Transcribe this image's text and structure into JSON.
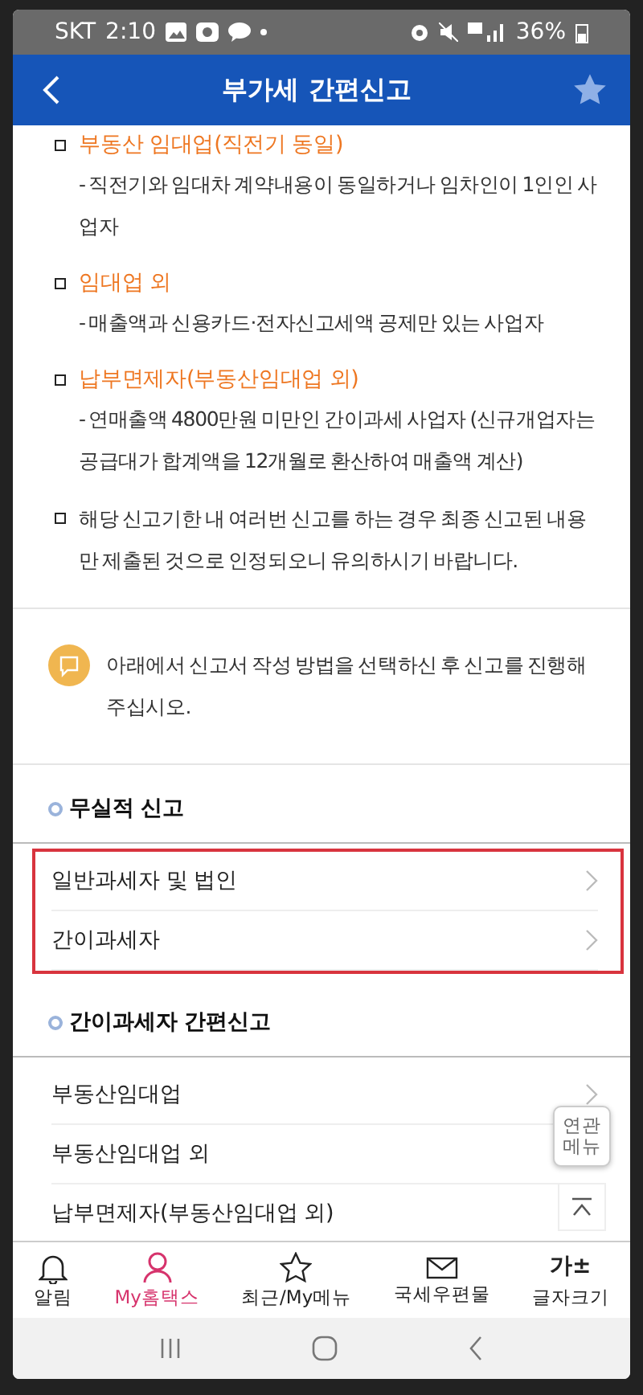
{
  "status_bar": {
    "carrier": "SKT",
    "time": "2:10",
    "battery": "36%"
  },
  "header": {
    "title": "부가세 간편신고",
    "favorite": false
  },
  "notices": [
    {
      "kind": "titled",
      "title": "부동산 임대업(직전기 동일)",
      "text": "- 직전기와 임대차 계약내용이 동일하거나 임차인이 1인인 사업자"
    },
    {
      "kind": "titled",
      "title": "임대업 외",
      "text": "- 매출액과 신용카드·전자신고세액 공제만 있는 사업자"
    },
    {
      "kind": "titled",
      "title": "납부면제자(부동산임대업 외)",
      "text": "- 연매출액 4800만원 미만인 간이과세 사업자 (신규개업자는 공급대가 합계액을 12개월로 환산하여 매출액 계산)"
    },
    {
      "kind": "plain",
      "text": "해당 신고기한 내 여러번 신고를 하는 경우 최종 신고된 내용만 제출된 것으로 인정되오니 유의하시기 바랍니다."
    }
  ],
  "info": "아래에서 신고서 작성 방법을 선택하신 후 신고를 진행해 주십시오.",
  "sections": [
    {
      "title": "무실적 신고",
      "highlighted": true,
      "items": [
        {
          "label": "일반과세자 및 법인",
          "arrow": true
        },
        {
          "label": "간이과세자",
          "arrow": true
        }
      ]
    },
    {
      "title": "간이과세자 간편신고",
      "highlighted": false,
      "items": [
        {
          "label": "부동산임대업",
          "arrow": true
        },
        {
          "label": "부동산임대업 외"
        },
        {
          "label": "납부면제자(부동산임대업 외)"
        }
      ]
    }
  ],
  "floating": {
    "related_menu": [
      "연관",
      "메뉴"
    ]
  },
  "bottom_nav": [
    {
      "kind": "bell",
      "label": "알림",
      "selected": false
    },
    {
      "kind": "person",
      "label": "My홈택스",
      "selected": true
    },
    {
      "kind": "star",
      "label": "최근/My메뉴",
      "selected": false
    },
    {
      "kind": "mail",
      "label": "국세우편물",
      "selected": false
    },
    {
      "kind": "font",
      "label": "글자크기",
      "glyph": "가±",
      "selected": false
    }
  ]
}
